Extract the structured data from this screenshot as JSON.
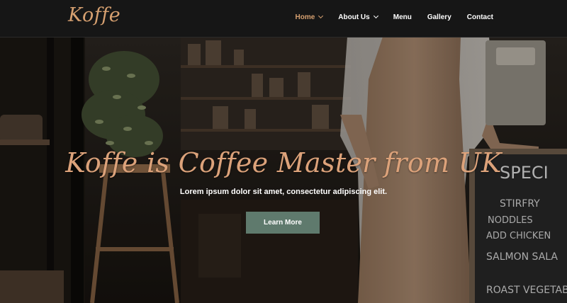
{
  "brand": {
    "logo_text": "Koffe"
  },
  "nav": {
    "items": [
      {
        "label": "Home",
        "active": true,
        "dropdown": true
      },
      {
        "label": "About Us",
        "active": false,
        "dropdown": true
      },
      {
        "label": "Menu",
        "active": false,
        "dropdown": false
      },
      {
        "label": "Gallery",
        "active": false,
        "dropdown": false
      },
      {
        "label": "Contact",
        "active": false,
        "dropdown": false
      }
    ]
  },
  "hero": {
    "title": "Koffe is Coffee Master from UK",
    "subtitle": "Lorem ipsum dolor sit amet, consectetur adipiscing elit.",
    "cta_label": "Learn More",
    "chalkboard_lines": [
      "SPECI",
      "STIRFRY",
      "NODDLES",
      "ADD CHICKEN",
      "SALMON SALA",
      "ROAST VEGETAB"
    ]
  },
  "colors": {
    "accent": "#d6a070",
    "button": "#5f7a6d",
    "header_bg": "#161616"
  }
}
